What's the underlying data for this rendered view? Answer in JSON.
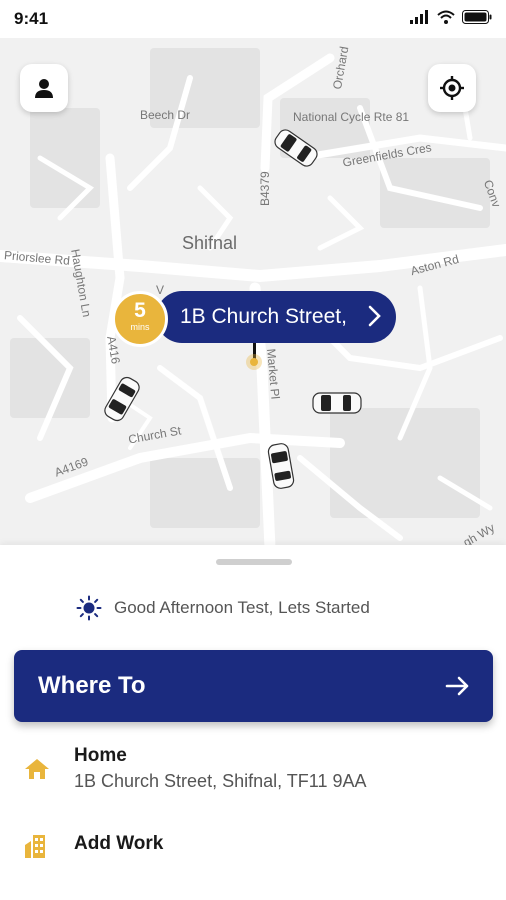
{
  "status_bar": {
    "time": "9:41"
  },
  "map": {
    "labels": {
      "beech": "Beech Dr",
      "orchard": "Orchard",
      "ncr": "National Cycle Rte 81",
      "greenfields": "Greenfields Cres",
      "haughton": "Haughton Ln",
      "b4379": "B4379",
      "shifnal": "Shifnal",
      "priorslee": "Priorslee Rd",
      "aston": "Aston Rd",
      "a416": "A416",
      "market": "Market Pl",
      "church": "Church St",
      "a4169": "A4169",
      "v": "V",
      "conv": "Conv",
      "hwy": "gh Wy"
    },
    "pickup": {
      "eta_value": "5",
      "eta_unit": "mins",
      "address": "1B Church Street,"
    }
  },
  "sheet": {
    "greeting": "Good Afternoon Test, Lets Started",
    "where_to": "Where To",
    "places": [
      {
        "title": "Home",
        "address": "1B Church Street, Shifnal, TF11 9AA",
        "icon": "home-icon"
      },
      {
        "title": "Add Work",
        "address": "",
        "icon": "work-building-icon"
      }
    ]
  },
  "colors": {
    "primary": "#1b2b7f",
    "accent": "#e9b53c"
  }
}
